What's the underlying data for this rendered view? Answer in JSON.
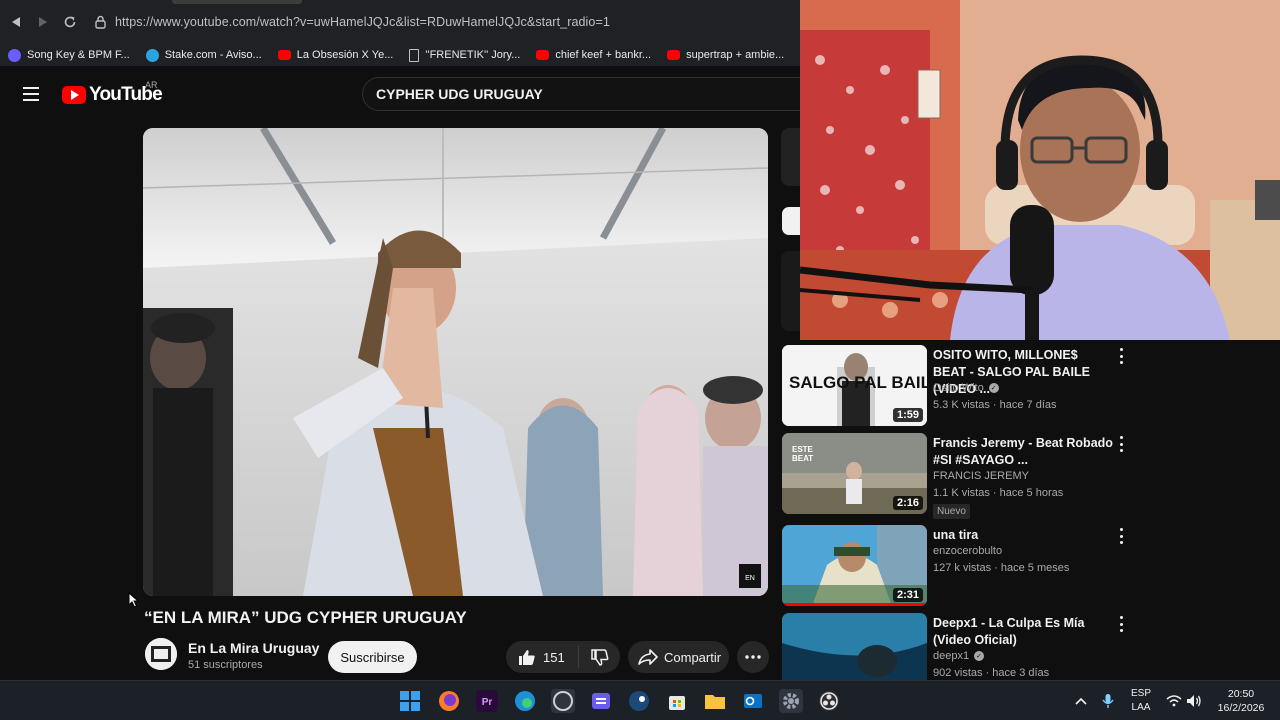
{
  "browser": {
    "url": "https://www.youtube.com/watch?v=uwHamelJQJc&list=RDuwHamelJQJc&start_radio=1",
    "bookmarks": [
      {
        "label": "Song Key & BPM F...",
        "icon": "music-note-icon",
        "color": "#6a5cff"
      },
      {
        "label": "Stake.com - Aviso...",
        "icon": "telegram-icon",
        "color": "#2aa3e0"
      },
      {
        "label": "La Obsesión X Ye...",
        "icon": "youtube-icon",
        "color": "#ff0000"
      },
      {
        "label": "''FRENETIK'' Jory...",
        "icon": "document-icon",
        "color": "#bdc1c6"
      },
      {
        "label": "chief keef + bankr...",
        "icon": "youtube-icon",
        "color": "#ff0000"
      },
      {
        "label": "supertrap + ambie...",
        "icon": "youtube-icon",
        "color": "#ff0000"
      }
    ]
  },
  "youtube": {
    "logo_text": "YouTube",
    "country_code": "AR",
    "search_query": "CYPHER UDG URUGUAY",
    "video": {
      "title": "“EN LA MIRA” UDG CYPHER URUGUAY",
      "channel": "En La Mira Uruguay",
      "subscribers": "51 suscriptores",
      "subscribe_label": "Suscribirse",
      "likes": "151",
      "share_label": "Compartir",
      "watermark": "EN LA MIRA"
    },
    "recommendations": [
      {
        "title": "OSITO WITO, MILLONE$ BEAT - SALGO PAL BAILE (VIDEO ...",
        "channel": "Osito Wito",
        "verified": true,
        "meta": "5.3 K vistas · hace 7 días",
        "duration": "1:59",
        "badge": "",
        "thumb_text": "SALGO PAL BAILE"
      },
      {
        "title": "Francis Jeremy - Beat Robado #SI #SAYAGO ...",
        "channel": "FRANCIS JEREMY",
        "verified": false,
        "meta": "1.1 K vistas · hace 5 horas",
        "duration": "2:16",
        "badge": "Nuevo",
        "thumb_text": "ESTE BEAT"
      },
      {
        "title": "una tira",
        "channel": "enzocerobulto",
        "verified": false,
        "meta": "127 k vistas · hace 5 meses",
        "duration": "2:31",
        "badge": "",
        "thumb_text": ""
      },
      {
        "title": "Deepx1 - La Culpa Es Mía (Video Oficial)",
        "channel": "deepx1",
        "verified": true,
        "meta": "902 vistas · hace 3 días",
        "duration": "",
        "badge": "",
        "thumb_text": ""
      }
    ]
  },
  "taskbar": {
    "apps": [
      "windows-start-icon",
      "firefox-icon",
      "premiere-icon",
      "edge-icon",
      "obs-icon",
      "notes-icon",
      "steam-icon",
      "store-icon",
      "file-explorer-icon",
      "outlook-icon",
      "settings-icon",
      "obs-studio-icon"
    ],
    "language": "ESP",
    "layout": "LAA",
    "time": "20:50",
    "date": "16/2/2026"
  },
  "colors": {
    "accent": "#ff0000",
    "background": "#0f0f0f",
    "chip": "#272727"
  }
}
